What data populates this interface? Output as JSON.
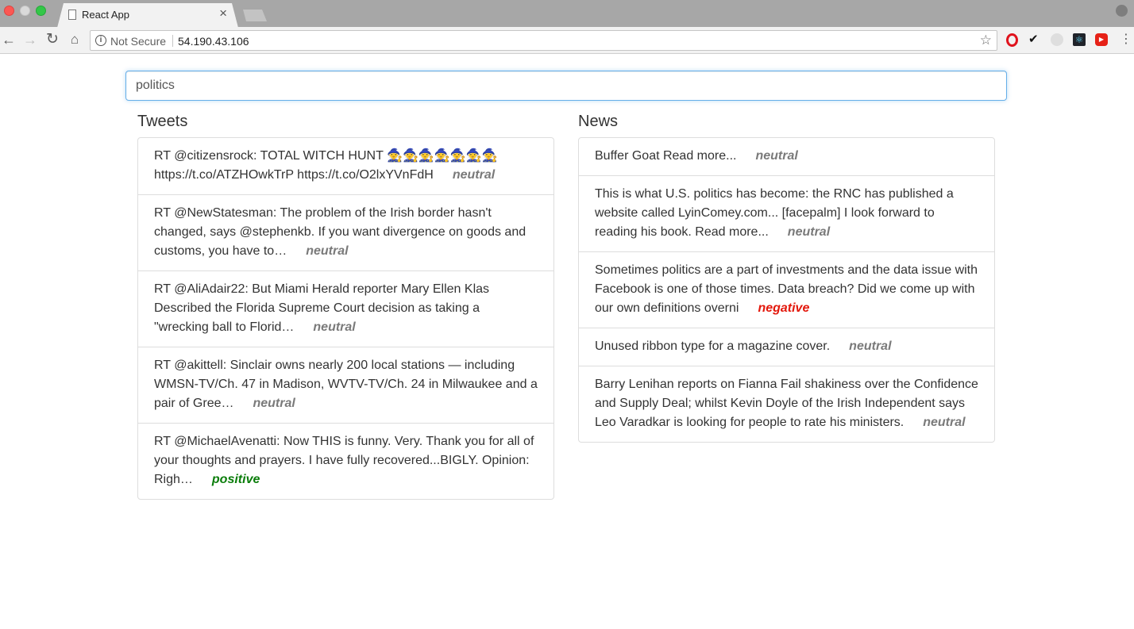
{
  "browser": {
    "tab_title": "React App",
    "tab_close": "×",
    "security_label": "Not Secure",
    "url": "54.190.43.106"
  },
  "search": {
    "value": "politics"
  },
  "tweets": {
    "title": "Tweets",
    "items": [
      {
        "text": "RT @citizensrock: TOTAL WITCH HUNT 🧙🧙🧙🧙🧙🧙🧙 https://t.co/ATZHOwkTrP https://t.co/O2lxYVnFdH",
        "sentiment": "neutral"
      },
      {
        "text": "RT @NewStatesman: The problem of the Irish border hasn't changed, says @stephenkb. If you want divergence on goods and customs, you have to…",
        "sentiment": "neutral"
      },
      {
        "text": "RT @AliAdair22: But Miami Herald reporter Mary Ellen Klas Described the Florida Supreme Court decision as taking a \"wrecking ball to Florid…",
        "sentiment": "neutral"
      },
      {
        "text": "RT @akittell: Sinclair owns nearly 200 local stations — including WMSN-TV/Ch. 47 in Madison, WVTV-TV/Ch. 24 in Milwaukee and a pair of Gree…",
        "sentiment": "neutral"
      },
      {
        "text": "RT @MichaelAvenatti: Now THIS is funny. Very. Thank you for all of your thoughts and prayers. I have fully recovered...BIGLY. Opinion: Righ…",
        "sentiment": "positive"
      }
    ]
  },
  "news": {
    "title": "News",
    "items": [
      {
        "text": "Buffer Goat Read more...",
        "sentiment": "neutral"
      },
      {
        "text": "This is what U.S. politics has become: the RNC has published a website called LyinComey.com... [facepalm] I look forward to reading his book. Read more...",
        "sentiment": "neutral"
      },
      {
        "text": "Sometimes politics are a part of investments and the data issue with Facebook is one of those times. Data breach? Did we come up with our own definitions overni",
        "sentiment": "negative"
      },
      {
        "text": "Unused ribbon type for a magazine cover.",
        "sentiment": "neutral"
      },
      {
        "text": "Barry Lenihan reports on Fianna Fail shakiness over the Confidence and Supply Deal; whilst Kevin Doyle of the Irish Independent says Leo Varadkar is looking for people to rate his ministers.",
        "sentiment": "neutral"
      }
    ]
  },
  "colors": {
    "neutral": "#7a7a7a",
    "positive": "#0a7d0a",
    "negative": "#e3180c",
    "focus_border": "#66afe9"
  }
}
